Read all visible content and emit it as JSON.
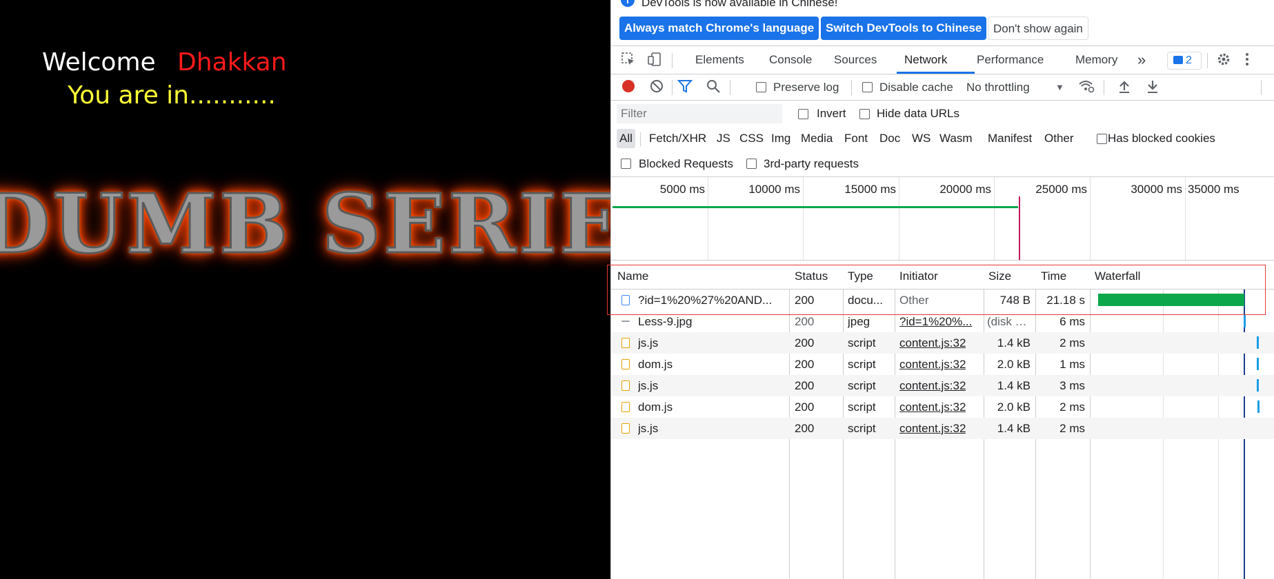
{
  "page": {
    "welcome": "Welcome",
    "username": "Dhakkan",
    "status": "You are in...........",
    "banner": "DUMB SERIES"
  },
  "devtools": {
    "infobar": {
      "message": "DevTools is now available in Chinese!",
      "btn_match": "Always match Chrome's language",
      "btn_switch": "Switch DevTools to Chinese",
      "btn_dont": "Don't show again"
    },
    "tabs": [
      "Elements",
      "Console",
      "Sources",
      "Network",
      "Performance",
      "Memory"
    ],
    "active_tab": "Network",
    "more_tabs": "»",
    "issues_count": "2",
    "toolbar": {
      "preserve_log": "Preserve log",
      "disable_cache": "Disable cache",
      "throttling": "No throttling"
    },
    "filter": {
      "placeholder": "Filter",
      "invert": "Invert",
      "hide_data_urls": "Hide data URLs"
    },
    "types": [
      "All",
      "Fetch/XHR",
      "JS",
      "CSS",
      "Img",
      "Media",
      "Font",
      "Doc",
      "WS",
      "Wasm",
      "Manifest",
      "Other"
    ],
    "has_blocked_cookies": "Has blocked cookies",
    "blocked_requests": "Blocked Requests",
    "third_party": "3rd-party requests",
    "timeline_ticks": [
      "5000 ms",
      "10000 ms",
      "15000 ms",
      "20000 ms",
      "25000 ms",
      "30000 ms",
      "35000 ms"
    ],
    "columns": [
      "Name",
      "Status",
      "Type",
      "Initiator",
      "Size",
      "Time",
      "Waterfall"
    ],
    "rows": [
      {
        "name": "?id=1%20%27%20AND...",
        "status": "200",
        "type": "docu...",
        "initiator": "Other",
        "size": "748 B",
        "time": "21.18 s"
      },
      {
        "name": "Less-9.jpg",
        "status": "200",
        "type": "jpeg",
        "initiator": "?id=1%20%...",
        "size": "(disk c...",
        "time": "6 ms"
      },
      {
        "name": "js.js",
        "status": "200",
        "type": "script",
        "initiator": "content.js:32",
        "size": "1.4 kB",
        "time": "2 ms"
      },
      {
        "name": "dom.js",
        "status": "200",
        "type": "script",
        "initiator": "content.js:32",
        "size": "2.0 kB",
        "time": "1 ms"
      },
      {
        "name": "js.js",
        "status": "200",
        "type": "script",
        "initiator": "content.js:32",
        "size": "1.4 kB",
        "time": "3 ms"
      },
      {
        "name": "dom.js",
        "status": "200",
        "type": "script",
        "initiator": "content.js:32",
        "size": "2.0 kB",
        "time": "2 ms"
      },
      {
        "name": "js.js",
        "status": "200",
        "type": "script",
        "initiator": "content.js:32",
        "size": "1.4 kB",
        "time": "2 ms"
      }
    ]
  }
}
